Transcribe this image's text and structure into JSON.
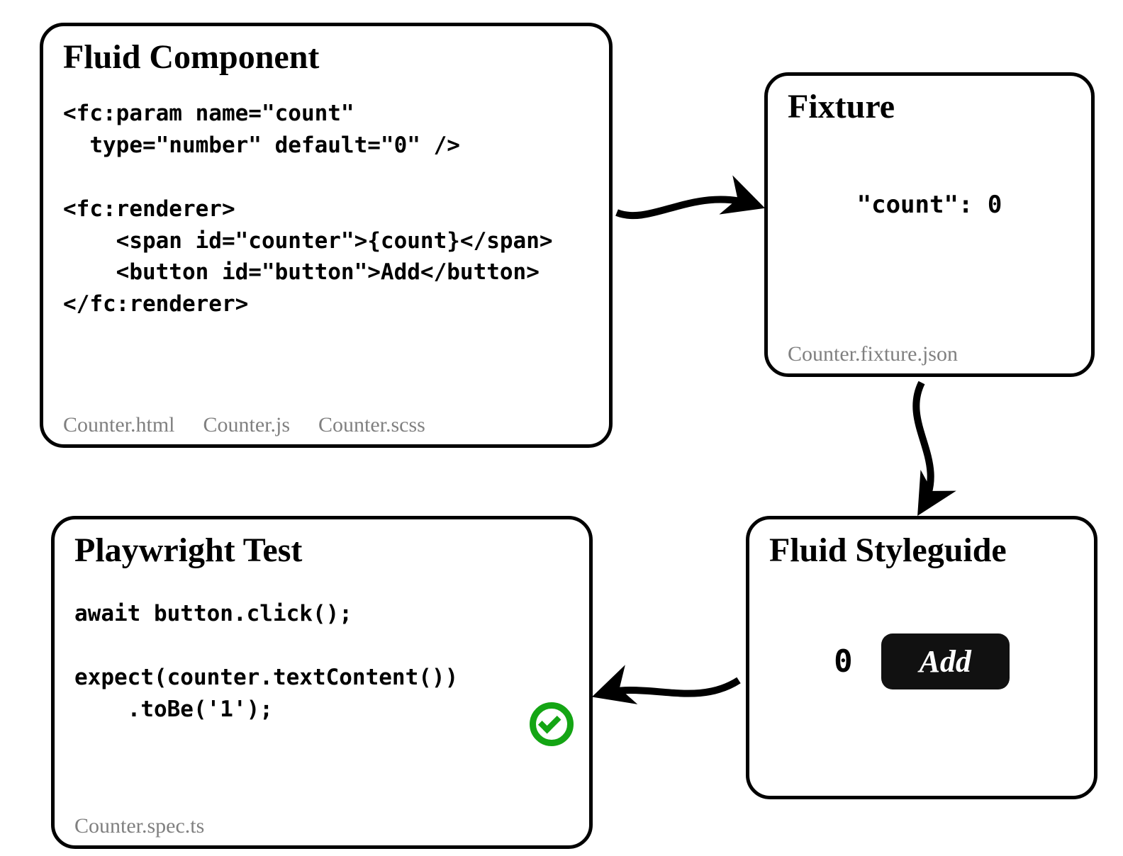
{
  "boxes": {
    "component": {
      "title": "Fluid Component",
      "code": "<fc:param name=\"count\"\n  type=\"number\" default=\"0\" />\n\n<fc:renderer>\n    <span id=\"counter\">{count}</span>\n    <button id=\"button\">Add</button>\n</fc:renderer>",
      "files": [
        "Counter.html",
        "Counter.js",
        "Counter.scss"
      ]
    },
    "fixture": {
      "title": "Fixture",
      "code": "\"count\": 0",
      "files": [
        "Counter.fixture.json"
      ]
    },
    "styleguide": {
      "title": "Fluid Styleguide",
      "counterValue": "0",
      "buttonLabel": "Add"
    },
    "playwright": {
      "title": "Playwright Test",
      "code": "await button.click();\n\nexpect(counter.textContent())\n    .toBe('1');",
      "files": [
        "Counter.spec.ts"
      ]
    }
  },
  "arrows": [
    {
      "from": "component",
      "to": "fixture"
    },
    {
      "from": "fixture",
      "to": "styleguide"
    },
    {
      "from": "styleguide",
      "to": "playwright"
    }
  ]
}
